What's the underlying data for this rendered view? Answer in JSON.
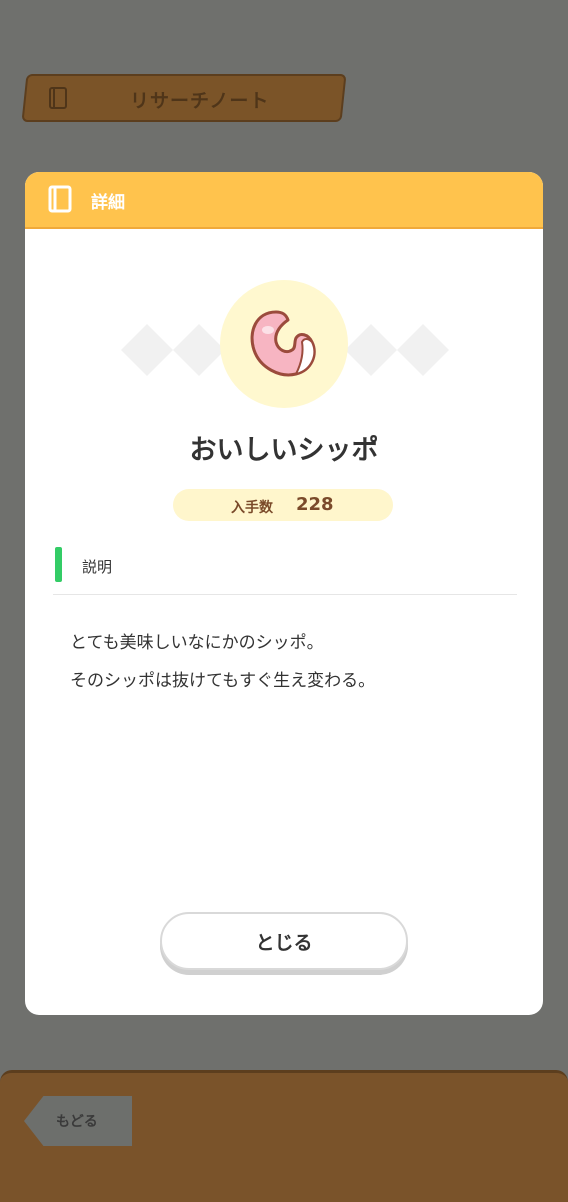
{
  "banner": {
    "title": "リサーチノート",
    "icon": "book-icon"
  },
  "dialog": {
    "header_title": "詳細",
    "header_icon": "book-icon",
    "item": {
      "name": "おいしいシッポ",
      "icon": "tail-icon",
      "count_label": "入手数",
      "count_value": "228"
    },
    "section_label": "説明",
    "description_lines": [
      "とても美味しいなにかのシッポ。",
      "そのシッポは抜けてもすぐ生え変わる。"
    ],
    "close_label": "とじる"
  },
  "footer": {
    "back_label": "もどる"
  },
  "colors": {
    "background_dim": "#6f706d",
    "header": "#ffc34d",
    "accent_green": "#33cc66",
    "count_pill": "#fff6cc",
    "wood": "#7a532a"
  }
}
